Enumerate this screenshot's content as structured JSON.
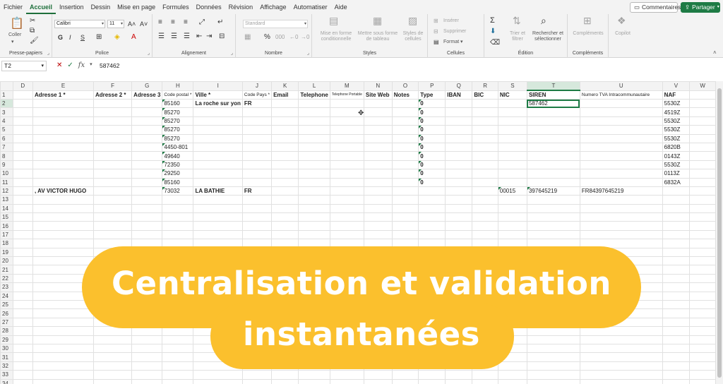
{
  "menu": {
    "tabs": [
      "Fichier",
      "Accueil",
      "Insertion",
      "Dessin",
      "Mise en page",
      "Formules",
      "Données",
      "Révision",
      "Affichage",
      "Automatiser",
      "Aide"
    ],
    "comments_label": "Commentaires",
    "share_label": "Partager"
  },
  "ribbon": {
    "clipboard": {
      "paste_label": "Coller",
      "group_label": "Presse-papiers"
    },
    "font": {
      "font_name": "Calibri",
      "font_size": "11",
      "bold": "G",
      "italic": "I",
      "underline": "S",
      "group_label": "Police"
    },
    "alignment": {
      "group_label": "Alignement"
    },
    "number": {
      "format": "Standard",
      "group_label": "Nombre"
    },
    "styles": {
      "conditional": "Mise en forme conditionnelle",
      "table": "Mettre sous forme de tableau",
      "cell_styles": "Styles de cellules",
      "group_label": "Styles"
    },
    "cells": {
      "insert": "Insérer",
      "delete": "Supprimer",
      "format": "Format",
      "group_label": "Cellules"
    },
    "editing": {
      "sort": "Trier et filtrer",
      "find": "Rechercher et sélectionner",
      "group_label": "Édition"
    },
    "addins": {
      "label": "Compléments",
      "group_label": "Compléments"
    },
    "copilot": {
      "label": "Copilot"
    }
  },
  "formula_bar": {
    "cell_ref": "T2",
    "value": "587462"
  },
  "sheet": {
    "columns": [
      "D",
      "E",
      "F",
      "G",
      "H",
      "I",
      "J",
      "K",
      "L",
      "M",
      "N",
      "O",
      "P",
      "Q",
      "R",
      "S",
      "T",
      "U",
      "V",
      "W"
    ],
    "headers": [
      "",
      "Adresse 1 *",
      "Adresse 2 *",
      "Adresse 3",
      "Code postal *",
      "Ville *",
      "Code Pays *",
      "Email",
      "Telephone",
      "Telephone Portable",
      "Site Web",
      "Notes",
      "Type",
      "IBAN",
      "BIC",
      "NIC",
      "SIREN",
      "Numero TVA Intracommunautaire",
      "NAF",
      ""
    ],
    "rows": [
      {
        "num": "2",
        "H": "85160",
        "I": "La roche sur yon",
        "J": "FR",
        "P": "0",
        "T": "587462",
        "V": "5530Z"
      },
      {
        "num": "3",
        "H": "85270",
        "P": "0",
        "V": "4519Z"
      },
      {
        "num": "4",
        "H": "85270",
        "P": "0",
        "V": "5530Z"
      },
      {
        "num": "5",
        "H": "85270",
        "P": "0",
        "V": "5530Z"
      },
      {
        "num": "6",
        "H": "85270",
        "P": "0",
        "V": "5530Z"
      },
      {
        "num": "7",
        "H": "4450-801",
        "P": "0",
        "V": "6820B"
      },
      {
        "num": "8",
        "H": "49640",
        "P": "0",
        "V": "0143Z"
      },
      {
        "num": "9",
        "H": "72350",
        "P": "0",
        "V": "5530Z"
      },
      {
        "num": "10",
        "H": "29250",
        "P": "0",
        "V": "0113Z"
      },
      {
        "num": "11",
        "H": "85160",
        "P": "0",
        "V": "6832A"
      },
      {
        "num": "12",
        "E": ", AV VICTOR HUGO",
        "H": "73032",
        "I": "LA BATHIE",
        "J": "FR",
        "S": "00015",
        "T": "397645219",
        "U": "FR84397645219"
      }
    ],
    "empty_rows": [
      "13",
      "14",
      "15",
      "16",
      "17",
      "18",
      "19",
      "20",
      "21",
      "22",
      "23",
      "24",
      "25",
      "26",
      "27",
      "28",
      "29",
      "30",
      "31",
      "32",
      "33",
      "34"
    ],
    "selected_cell": "T2"
  },
  "banner": {
    "line1": "Centralisation et validation",
    "line2": "instantanées",
    "color": "#FBC02D"
  }
}
